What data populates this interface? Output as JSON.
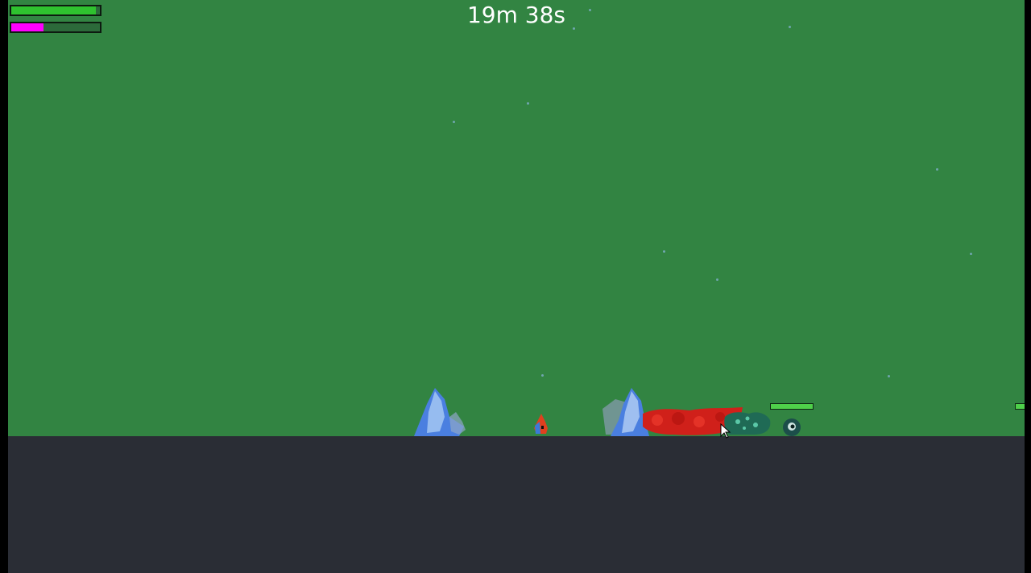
{
  "hud": {
    "timer": "19m 38s",
    "health": {
      "value": 0.95,
      "color": "#2fc22f"
    },
    "mana": {
      "value": 0.36,
      "color": "#ff00ff"
    }
  },
  "colors": {
    "sky": "#328442",
    "ground": "#2a2d35",
    "ice": "#4a7fe0",
    "fire": "#d0201a",
    "poison": "#1f6a55",
    "enemy": "#1c4e4a",
    "enemy_health": "#4fd04a"
  },
  "icons": [
    "ice-spike-icon",
    "player-icon",
    "fire-breath-icon",
    "poison-cloud-icon",
    "enemy-icon",
    "cursor-icon"
  ]
}
